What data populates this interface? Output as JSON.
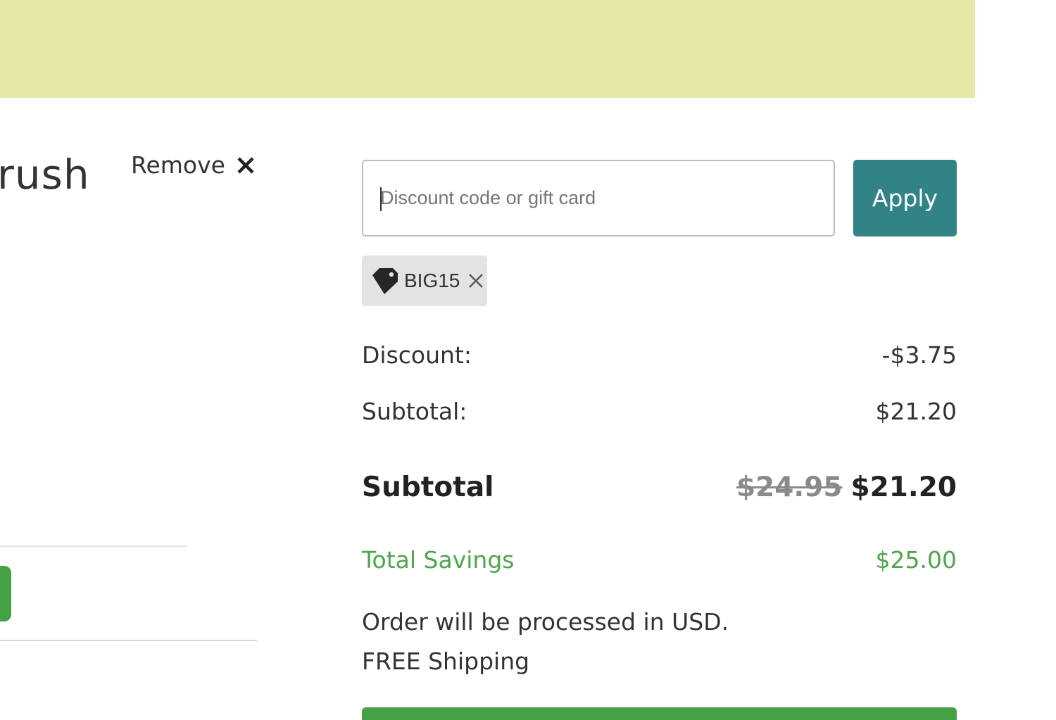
{
  "colors": {
    "banner": "#e7e7a8",
    "apply_button": "#328385",
    "savings_text": "#4aa84a",
    "checkout_button": "#44a244",
    "old_price": "#8a8a8a"
  },
  "product": {
    "name_fragment": "rush",
    "remove_label": "Remove",
    "remove_icon": "close-icon"
  },
  "discount_form": {
    "placeholder": "Discount code or gift card",
    "value": "",
    "apply_label": "Apply"
  },
  "applied_code": {
    "code": "BIG15",
    "icon": "tag-icon",
    "remove_icon": "close-icon"
  },
  "summary": {
    "discount_label": "Discount:",
    "discount_value": "-$3.75",
    "subtotal_label": "Subtotal:",
    "subtotal_value": "$21.20",
    "total_label": "Subtotal",
    "total_old_price": "$24.95",
    "total_price": "$21.20",
    "savings_label": "Total Savings",
    "savings_value": "$25.00"
  },
  "notes": {
    "currency": "Order will be processed in USD.",
    "shipping": "FREE Shipping"
  }
}
